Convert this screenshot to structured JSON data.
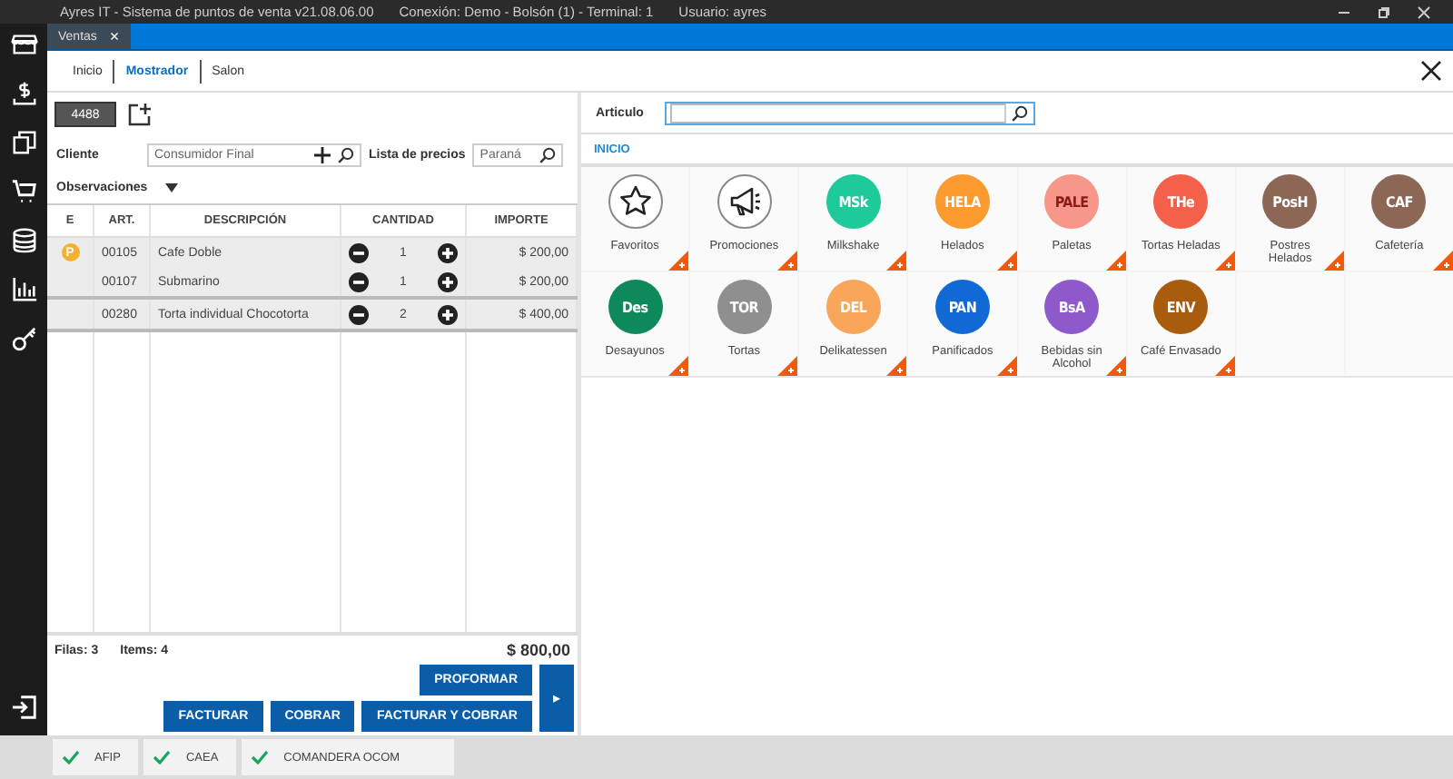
{
  "window": {
    "title": "Ayres IT - Sistema de puntos de venta v21.08.06.00",
    "connection": "Conexión: Demo - Bolsón (1) - Terminal: 1",
    "user": "Usuario: ayres"
  },
  "doc_tabs": [
    {
      "label": "Ventas",
      "close": "×",
      "selected": true
    }
  ],
  "nav_tabs": [
    {
      "label": "Inicio",
      "selected": false
    },
    {
      "label": "Mostrador",
      "selected": true
    },
    {
      "label": "Salon",
      "selected": false
    }
  ],
  "order_number": "4488",
  "cliente": {
    "label": "Cliente",
    "value": "Consumidor Final"
  },
  "price_list": {
    "label": "Lista de precios",
    "value": "Paraná"
  },
  "observaciones": "Observaciones",
  "table": {
    "columns": [
      "E",
      "ART.",
      "DESCRIPCIÓN",
      "CANTIDAD",
      "IMPORTE"
    ],
    "rows": [
      {
        "badge": "P",
        "art": "00105",
        "desc": "Cafe Doble",
        "qty": "1",
        "amount": "$ 200,00",
        "group_end": false
      },
      {
        "art": "00107",
        "desc": "Submarino",
        "qty": "1",
        "amount": "$ 200,00",
        "group_end": true
      },
      {
        "art": "00280",
        "desc": "Torta individual Chocotorta",
        "qty": "2",
        "amount": "$ 400,00",
        "group_end": true
      }
    ]
  },
  "totals": {
    "filas": "Filas: 3",
    "items": "Items: 4",
    "total": "$ 800,00"
  },
  "buttons_top": [
    "PROFORMAR"
  ],
  "buttons_bottom": [
    "FACTURAR",
    "COBRAR",
    "FACTURAR Y COBRAR"
  ],
  "more_button": "▸",
  "article": {
    "label": "Articulo"
  },
  "breadcrumb": "INICIO",
  "categories": [
    {
      "kind": "star",
      "label": "Favoritos"
    },
    {
      "kind": "megaphone",
      "label": "Promociones"
    },
    {
      "kind": "code",
      "code": "MSk",
      "color": "#1ec99a",
      "label": "Milkshake"
    },
    {
      "kind": "code",
      "code": "HELA",
      "color": "#fb9a2e",
      "label": "Helados"
    },
    {
      "kind": "light",
      "code": "PALE",
      "color": "#f7978a",
      "label": "Paletas"
    },
    {
      "kind": "code",
      "code": "THe",
      "color": "#f4604a",
      "label": "Tortas Heladas"
    },
    {
      "kind": "code",
      "code": "PosH",
      "color": "#8d6755",
      "label": "Postres Helados"
    },
    {
      "kind": "code",
      "code": "CAF",
      "color": "#8d6755",
      "label": "Cafetería"
    },
    {
      "kind": "code",
      "code": "Des",
      "color": "#0e8a5a",
      "label": "Desayunos"
    },
    {
      "kind": "code",
      "code": "TOR",
      "color": "#8f8f8f",
      "label": "Tortas"
    },
    {
      "kind": "code",
      "code": "DEL",
      "color": "#f8a65a",
      "label": "Delikatessen"
    },
    {
      "kind": "code",
      "code": "PAN",
      "color": "#1169d6",
      "label": "Panificados"
    },
    {
      "kind": "code",
      "code": "BsA",
      "color": "#8e5acb",
      "label": "Bebidas sin Alcohol"
    },
    {
      "kind": "code",
      "code": "ENV",
      "color": "#a95c0e",
      "label": "Café Envasado"
    }
  ],
  "status": [
    {
      "label": "AFIP",
      "ok": true
    },
    {
      "label": "CAEA",
      "ok": true
    },
    {
      "label": "COMANDERA OCOM",
      "ok": true
    }
  ]
}
